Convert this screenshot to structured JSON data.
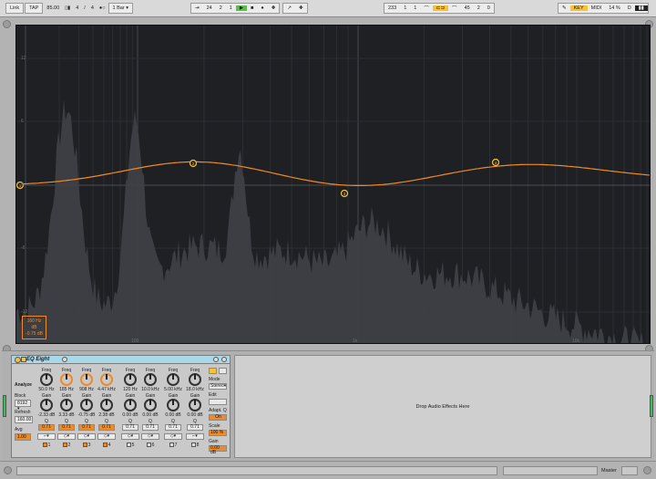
{
  "toolbar": {
    "link": "Link",
    "tap": "TAP",
    "tempo": "85.00",
    "sig_num": "4",
    "sig_sep": "/",
    "sig_den": "4",
    "quantize": "1 Bar",
    "pos_bar": "24",
    "pos_beat": "2",
    "pos_sixteenth": "1",
    "loop_start": "233",
    "loop_a": "1",
    "loop_b": "1",
    "loop_len": "45",
    "loop_c": "2",
    "loop_d": "0",
    "key": "KEY",
    "midi": "MIDI",
    "cpu": "14 %",
    "d_label": "D"
  },
  "eq_display": {
    "db_ticks": [
      "12",
      "6",
      "0",
      "-6",
      "-12"
    ],
    "freq_ticks": [
      "100",
      "1k",
      "10k"
    ],
    "readout": [
      "160 Hz",
      "dB",
      "-0.75 dB"
    ],
    "band_markers": [
      "1",
      "2",
      "3",
      "4"
    ]
  },
  "device": {
    "name": "EQ Eight",
    "analyze": "Analyze",
    "block_label": "Block",
    "block_value": "8192",
    "refresh_label": "Refresh",
    "refresh_value": "160.00",
    "avg_label": "Avg",
    "avg_value": "1.00",
    "mode_label": "Mode",
    "mode_value": "Stereo",
    "edit_label": "Edit",
    "edit_value": "",
    "adapt_label": "Adapt. Q",
    "adapt_value": "On",
    "scale_label": "Scale",
    "scale_value": "100 %",
    "gain_label": "Gain",
    "gain_value": "0.00 dB",
    "bands": [
      {
        "freq_label": "Freq",
        "freq": "50.0 Hz",
        "gain_label": "Gain",
        "gain": "-2.33 dB",
        "q_label": "Q",
        "q": "0.71",
        "num": "1",
        "active": true
      },
      {
        "freq_label": "Freq",
        "freq": "185 Hz",
        "gain_label": "Gain",
        "gain": "3.33 dB",
        "q_label": "Q",
        "q": "0.71",
        "num": "2",
        "active": true
      },
      {
        "freq_label": "Freq",
        "freq": "908 Hz",
        "gain_label": "Gain",
        "gain": "-0.75 dB",
        "q_label": "Q",
        "q": "0.71",
        "num": "3",
        "active": true
      },
      {
        "freq_label": "Freq",
        "freq": "4.47 kHz",
        "gain_label": "Gain",
        "gain": "2.38 dB",
        "q_label": "Q",
        "q": "0.71",
        "num": "4",
        "active": true
      },
      {
        "freq_label": "Freq",
        "freq": "120 Hz",
        "gain_label": "Gain",
        "gain": "0.00 dB",
        "q_label": "Q",
        "q": "0.71",
        "num": "5",
        "active": false
      },
      {
        "freq_label": "Freq",
        "freq": "10.0 kHz",
        "gain_label": "Gain",
        "gain": "0.00 dB",
        "q_label": "Q",
        "q": "0.71",
        "num": "6",
        "active": false
      },
      {
        "freq_label": "Freq",
        "freq": "5.00 kHz",
        "gain_label": "Gain",
        "gain": "0.00 dB",
        "q_label": "Q",
        "q": "0.71",
        "num": "7",
        "active": false
      },
      {
        "freq_label": "Freq",
        "freq": "18.0 kHz",
        "gain_label": "Gain",
        "gain": "0.00 dB",
        "q_label": "Q",
        "q": "0.71",
        "num": "8",
        "active": false
      }
    ]
  },
  "drop_area": {
    "text": "Drop Audio Effects Here"
  },
  "bottom": {
    "master": "Master"
  },
  "colors": {
    "accent": "#f08a24",
    "marker": "#f5c23b",
    "device_title": "#a9d9e9",
    "display_bg": "#1f2024",
    "spectrum": "#3e4046"
  }
}
